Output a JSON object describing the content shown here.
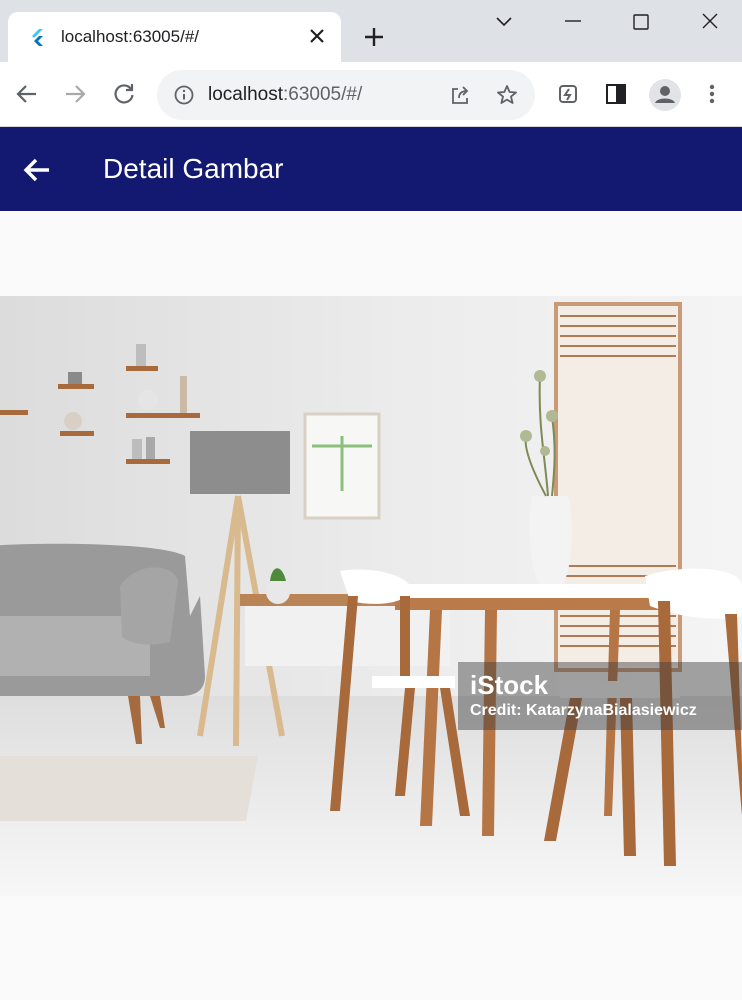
{
  "browser": {
    "tab_title": "localhost:63005/#/",
    "url_host": "localhost",
    "url_path": ":63005/#/"
  },
  "appbar": {
    "title": "Detail Gambar"
  },
  "image": {
    "watermark_logo": "iStock",
    "watermark_credit": "Credit: KatarzynaBialasiewicz"
  },
  "colors": {
    "appbar_bg": "#131870",
    "tabstrip_bg": "#dee1e6",
    "page_bg": "#fafafa"
  }
}
